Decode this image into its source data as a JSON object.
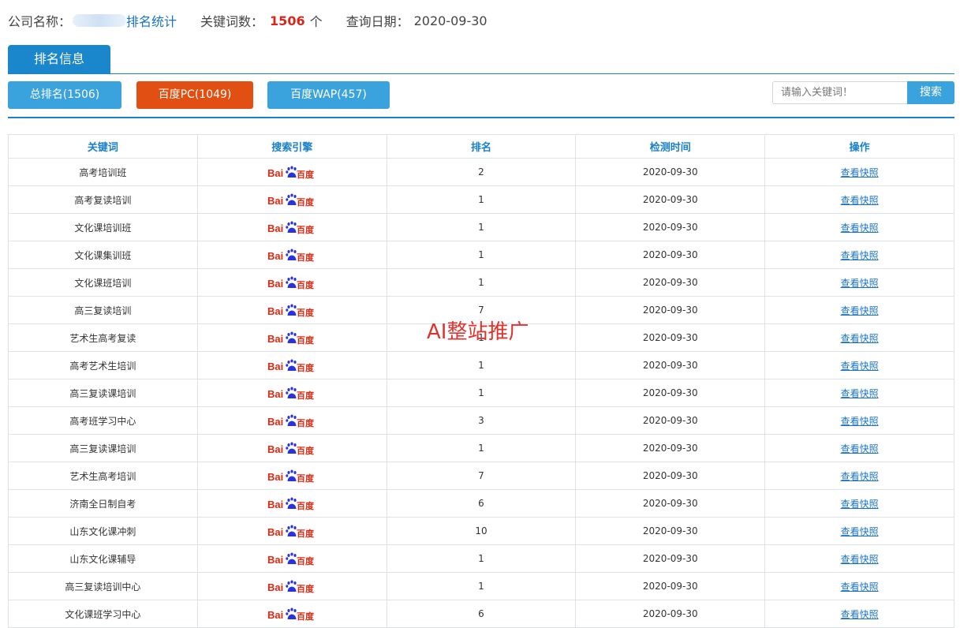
{
  "header": {
    "company_label": "公司名称：",
    "company_name_suffix": "排名统计",
    "keyword_count_label": "关键词数：",
    "keyword_count": "1506",
    "keyword_count_unit": "个",
    "query_date_label": "查询日期：",
    "query_date": "2020-09-30"
  },
  "tab": {
    "label": "排名信息"
  },
  "filters": [
    {
      "label": "总排名(1506)"
    },
    {
      "label": "百度PC(1049)"
    },
    {
      "label": "百度WAP(457)"
    }
  ],
  "search": {
    "placeholder": "请输入关键词！",
    "button_label": "搜索"
  },
  "table": {
    "headers": [
      "关键词",
      "搜索引擎",
      "排名",
      "检测时间",
      "操作"
    ],
    "logo_text": {
      "bai": "Bai",
      "du": "百度"
    },
    "rows": [
      {
        "keyword": "高考培训班",
        "rank": "2",
        "date": "2020-09-30",
        "action": "查看快照"
      },
      {
        "keyword": "高考复读培训",
        "rank": "1",
        "date": "2020-09-30",
        "action": "查看快照"
      },
      {
        "keyword": "文化课培训班",
        "rank": "1",
        "date": "2020-09-30",
        "action": "查看快照"
      },
      {
        "keyword": "文化课集训班",
        "rank": "1",
        "date": "2020-09-30",
        "action": "查看快照"
      },
      {
        "keyword": "文化课班培训",
        "rank": "1",
        "date": "2020-09-30",
        "action": "查看快照"
      },
      {
        "keyword": "高三复读培训",
        "rank": "7",
        "date": "2020-09-30",
        "action": "查看快照"
      },
      {
        "keyword": "艺术生高考复读",
        "rank": "1",
        "date": "2020-09-30",
        "action": "查看快照"
      },
      {
        "keyword": "高考艺术生培训",
        "rank": "1",
        "date": "2020-09-30",
        "action": "查看快照"
      },
      {
        "keyword": "高三复读课培训",
        "rank": "1",
        "date": "2020-09-30",
        "action": "查看快照"
      },
      {
        "keyword": "高考班学习中心",
        "rank": "3",
        "date": "2020-09-30",
        "action": "查看快照"
      },
      {
        "keyword": "高三复读课培训",
        "rank": "1",
        "date": "2020-09-30",
        "action": "查看快照"
      },
      {
        "keyword": "艺术生高考培训",
        "rank": "7",
        "date": "2020-09-30",
        "action": "查看快照"
      },
      {
        "keyword": "济南全日制自考",
        "rank": "6",
        "date": "2020-09-30",
        "action": "查看快照"
      },
      {
        "keyword": "山东文化课冲刺",
        "rank": "10",
        "date": "2020-09-30",
        "action": "查看快照"
      },
      {
        "keyword": "山东文化课辅导",
        "rank": "1",
        "date": "2020-09-30",
        "action": "查看快照"
      },
      {
        "keyword": "高三复读培训中心",
        "rank": "1",
        "date": "2020-09-30",
        "action": "查看快照"
      },
      {
        "keyword": "文化课班学习中心",
        "rank": "6",
        "date": "2020-09-30",
        "action": "查看快照"
      }
    ]
  },
  "watermark": "AI整站推广",
  "colors": {
    "accent": "#1a80c8",
    "active_filter": "#e24f12",
    "count": "#d8261c",
    "watermark": "#e0332d"
  }
}
